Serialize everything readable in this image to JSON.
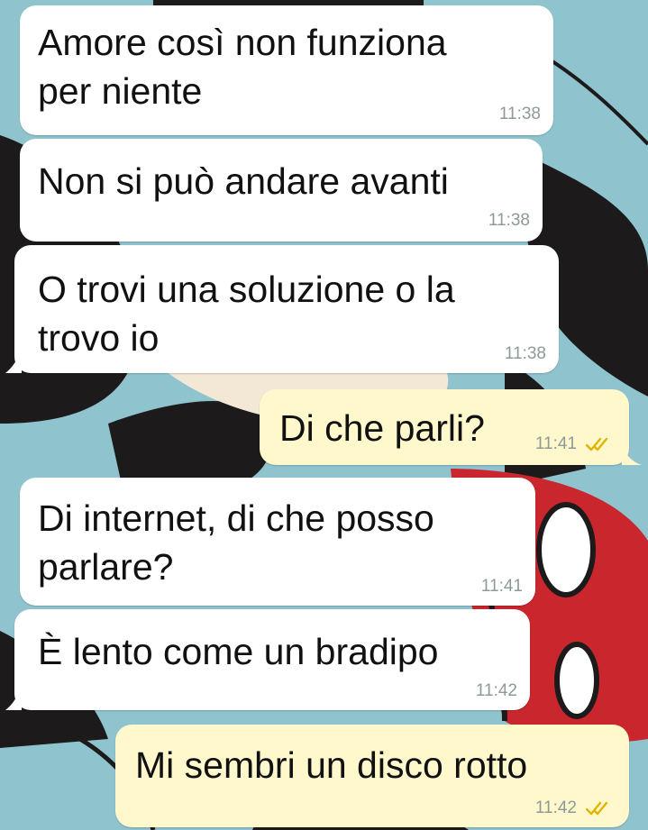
{
  "chat": {
    "messages": [
      {
        "direction": "incoming",
        "text": "Amore così non funziona\nper niente",
        "time": "11:38"
      },
      {
        "direction": "incoming",
        "text": "Non si può andare avanti",
        "time": "11:38"
      },
      {
        "direction": "incoming",
        "text": "O trovi una soluzione o la\ntrovo io",
        "time": "11:38"
      },
      {
        "direction": "outgoing",
        "text": "Di che parli?",
        "time": "11:41",
        "status": "read",
        "status_icon": "double-check-icon"
      },
      {
        "direction": "incoming",
        "text": "Di internet, di che posso\nparlare?",
        "time": "11:41"
      },
      {
        "direction": "incoming",
        "text": "È lento come un bradipo",
        "time": "11:42"
      },
      {
        "direction": "outgoing",
        "text": "Mi sembri un disco rotto",
        "time": "11:42",
        "status": "read",
        "status_icon": "double-check-icon"
      }
    ]
  },
  "colors": {
    "wallpaper": "#8fc3ce",
    "incoming_bubble": "#ffffff",
    "outgoing_bubble": "#fff8cd",
    "read_ticks": "#e0b400",
    "timestamp": "#8e9a97"
  },
  "wallpaper": {
    "icon": "cartoon-wallpaper"
  }
}
